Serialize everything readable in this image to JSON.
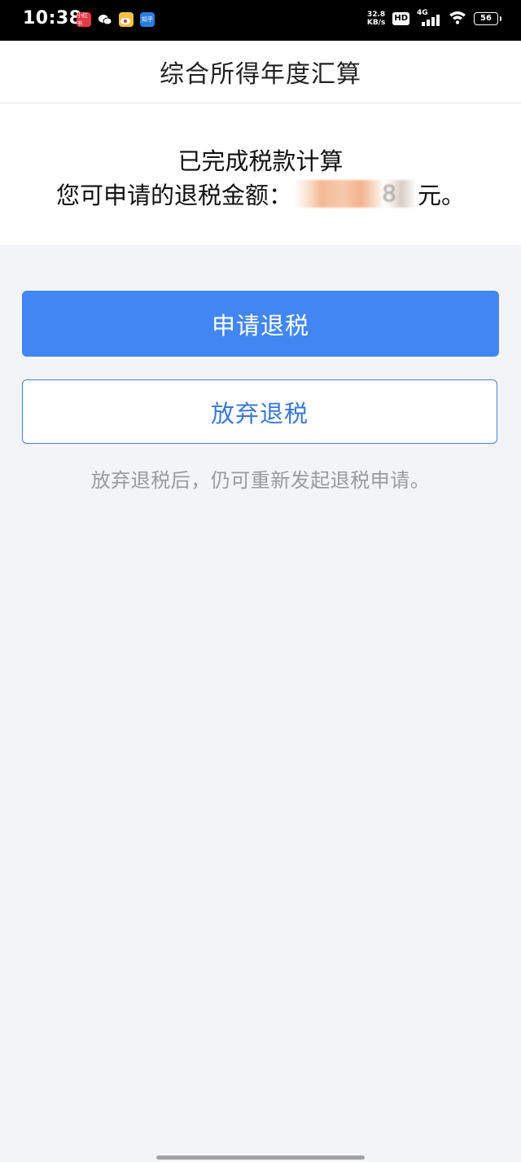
{
  "status_bar": {
    "time": "10:38",
    "net_speed_value": "32.8",
    "net_speed_unit": "KB/s",
    "hd_badge": "HD",
    "network_type": "4G",
    "battery": "56",
    "app_icons": [
      {
        "name": "xiaohongshu-icon",
        "label": "小红书"
      },
      {
        "name": "wechat-icon",
        "label": ""
      },
      {
        "name": "weibo-icon",
        "label": ""
      },
      {
        "name": "zhihu-icon",
        "label": "知乎"
      }
    ]
  },
  "header": {
    "title": "综合所得年度汇算"
  },
  "result": {
    "line1": "已完成税款计算",
    "refund_label": "您可申请的退税金额：",
    "refund_amount_visible_tail": "8",
    "refund_unit": "元。"
  },
  "actions": {
    "apply_label": "申请退税",
    "give_up_label": "放弃退税",
    "hint": "放弃退税后，仍可重新发起退税申请。"
  },
  "colors": {
    "primary": "#4286f3",
    "outline_text": "#3b77d6",
    "page_bg": "#f3f4f8",
    "hint_text": "#9a9a9e"
  }
}
